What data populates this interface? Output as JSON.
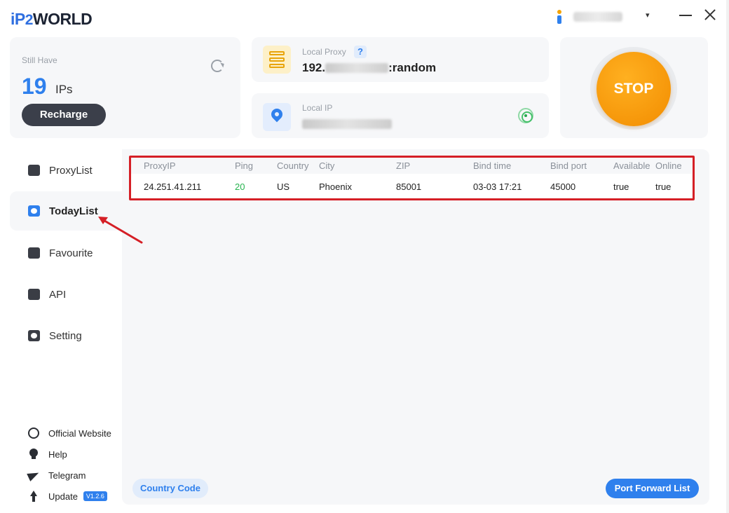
{
  "app": {
    "logo_parts": [
      "iP",
      "2",
      "WORLD"
    ],
    "user_name_blurred": true,
    "caret": "▾"
  },
  "stats": {
    "label": "Still Have",
    "count": "19",
    "unit": "IPs",
    "recharge_label": "Recharge"
  },
  "local_proxy": {
    "label": "Local Proxy",
    "help": "?",
    "value_prefix": "192.",
    "value_suffix": ":random"
  },
  "local_ip": {
    "label": "Local IP"
  },
  "stop_button": {
    "label": "STOP"
  },
  "sidebar": {
    "items": [
      {
        "label": "ProxyList"
      },
      {
        "label": "TodayList"
      },
      {
        "label": "Favourite"
      },
      {
        "label": "API"
      },
      {
        "label": "Setting"
      }
    ],
    "active_index": 1,
    "footer": [
      {
        "label": "Official Website"
      },
      {
        "label": "Help"
      },
      {
        "label": "Telegram"
      },
      {
        "label": "Update"
      }
    ],
    "version": "V1.2.6"
  },
  "table": {
    "columns": [
      "ProxyIP",
      "Ping",
      "Country",
      "City",
      "ZIP",
      "Bind time",
      "Bind port",
      "Available",
      "Online"
    ],
    "rows": [
      [
        "24.251.41.211",
        "20",
        "US",
        "Phoenix",
        "85001",
        "03-03 17:21",
        "45000",
        "true",
        "true"
      ]
    ]
  },
  "buttons": {
    "country_code": "Country Code",
    "port_forward": "Port Forward List"
  },
  "colors": {
    "accent": "#2f80ed",
    "stop": "#f28c00",
    "highlight": "#d51f26",
    "ping_good": "#27b34f"
  }
}
